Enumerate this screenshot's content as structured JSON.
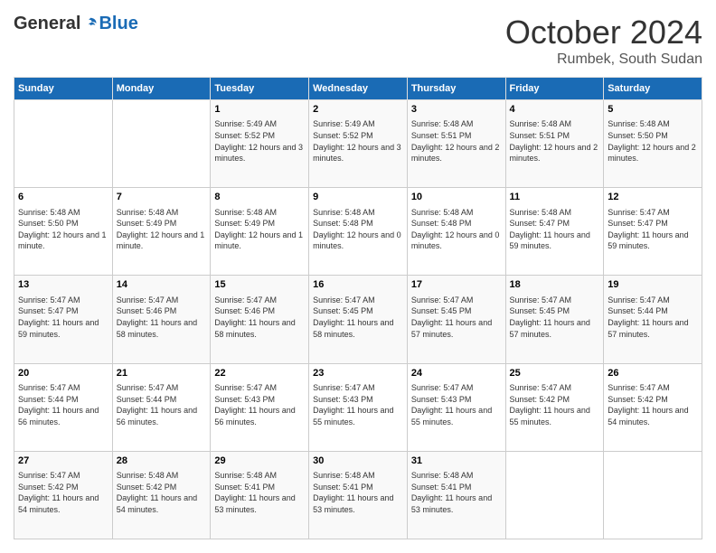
{
  "logo": {
    "general": "General",
    "blue": "Blue"
  },
  "header": {
    "month": "October 2024",
    "location": "Rumbek, South Sudan"
  },
  "days": [
    "Sunday",
    "Monday",
    "Tuesday",
    "Wednesday",
    "Thursday",
    "Friday",
    "Saturday"
  ],
  "weeks": [
    [
      {
        "day": "",
        "content": ""
      },
      {
        "day": "",
        "content": ""
      },
      {
        "day": "1",
        "content": "Sunrise: 5:49 AM\nSunset: 5:52 PM\nDaylight: 12 hours and 3 minutes."
      },
      {
        "day": "2",
        "content": "Sunrise: 5:49 AM\nSunset: 5:52 PM\nDaylight: 12 hours and 3 minutes."
      },
      {
        "day": "3",
        "content": "Sunrise: 5:48 AM\nSunset: 5:51 PM\nDaylight: 12 hours and 2 minutes."
      },
      {
        "day": "4",
        "content": "Sunrise: 5:48 AM\nSunset: 5:51 PM\nDaylight: 12 hours and 2 minutes."
      },
      {
        "day": "5",
        "content": "Sunrise: 5:48 AM\nSunset: 5:50 PM\nDaylight: 12 hours and 2 minutes."
      }
    ],
    [
      {
        "day": "6",
        "content": "Sunrise: 5:48 AM\nSunset: 5:50 PM\nDaylight: 12 hours and 1 minute."
      },
      {
        "day": "7",
        "content": "Sunrise: 5:48 AM\nSunset: 5:49 PM\nDaylight: 12 hours and 1 minute."
      },
      {
        "day": "8",
        "content": "Sunrise: 5:48 AM\nSunset: 5:49 PM\nDaylight: 12 hours and 1 minute."
      },
      {
        "day": "9",
        "content": "Sunrise: 5:48 AM\nSunset: 5:48 PM\nDaylight: 12 hours and 0 minutes."
      },
      {
        "day": "10",
        "content": "Sunrise: 5:48 AM\nSunset: 5:48 PM\nDaylight: 12 hours and 0 minutes."
      },
      {
        "day": "11",
        "content": "Sunrise: 5:48 AM\nSunset: 5:47 PM\nDaylight: 11 hours and 59 minutes."
      },
      {
        "day": "12",
        "content": "Sunrise: 5:47 AM\nSunset: 5:47 PM\nDaylight: 11 hours and 59 minutes."
      }
    ],
    [
      {
        "day": "13",
        "content": "Sunrise: 5:47 AM\nSunset: 5:47 PM\nDaylight: 11 hours and 59 minutes."
      },
      {
        "day": "14",
        "content": "Sunrise: 5:47 AM\nSunset: 5:46 PM\nDaylight: 11 hours and 58 minutes."
      },
      {
        "day": "15",
        "content": "Sunrise: 5:47 AM\nSunset: 5:46 PM\nDaylight: 11 hours and 58 minutes."
      },
      {
        "day": "16",
        "content": "Sunrise: 5:47 AM\nSunset: 5:45 PM\nDaylight: 11 hours and 58 minutes."
      },
      {
        "day": "17",
        "content": "Sunrise: 5:47 AM\nSunset: 5:45 PM\nDaylight: 11 hours and 57 minutes."
      },
      {
        "day": "18",
        "content": "Sunrise: 5:47 AM\nSunset: 5:45 PM\nDaylight: 11 hours and 57 minutes."
      },
      {
        "day": "19",
        "content": "Sunrise: 5:47 AM\nSunset: 5:44 PM\nDaylight: 11 hours and 57 minutes."
      }
    ],
    [
      {
        "day": "20",
        "content": "Sunrise: 5:47 AM\nSunset: 5:44 PM\nDaylight: 11 hours and 56 minutes."
      },
      {
        "day": "21",
        "content": "Sunrise: 5:47 AM\nSunset: 5:44 PM\nDaylight: 11 hours and 56 minutes."
      },
      {
        "day": "22",
        "content": "Sunrise: 5:47 AM\nSunset: 5:43 PM\nDaylight: 11 hours and 56 minutes."
      },
      {
        "day": "23",
        "content": "Sunrise: 5:47 AM\nSunset: 5:43 PM\nDaylight: 11 hours and 55 minutes."
      },
      {
        "day": "24",
        "content": "Sunrise: 5:47 AM\nSunset: 5:43 PM\nDaylight: 11 hours and 55 minutes."
      },
      {
        "day": "25",
        "content": "Sunrise: 5:47 AM\nSunset: 5:42 PM\nDaylight: 11 hours and 55 minutes."
      },
      {
        "day": "26",
        "content": "Sunrise: 5:47 AM\nSunset: 5:42 PM\nDaylight: 11 hours and 54 minutes."
      }
    ],
    [
      {
        "day": "27",
        "content": "Sunrise: 5:47 AM\nSunset: 5:42 PM\nDaylight: 11 hours and 54 minutes."
      },
      {
        "day": "28",
        "content": "Sunrise: 5:48 AM\nSunset: 5:42 PM\nDaylight: 11 hours and 54 minutes."
      },
      {
        "day": "29",
        "content": "Sunrise: 5:48 AM\nSunset: 5:41 PM\nDaylight: 11 hours and 53 minutes."
      },
      {
        "day": "30",
        "content": "Sunrise: 5:48 AM\nSunset: 5:41 PM\nDaylight: 11 hours and 53 minutes."
      },
      {
        "day": "31",
        "content": "Sunrise: 5:48 AM\nSunset: 5:41 PM\nDaylight: 11 hours and 53 minutes."
      },
      {
        "day": "",
        "content": ""
      },
      {
        "day": "",
        "content": ""
      }
    ]
  ]
}
